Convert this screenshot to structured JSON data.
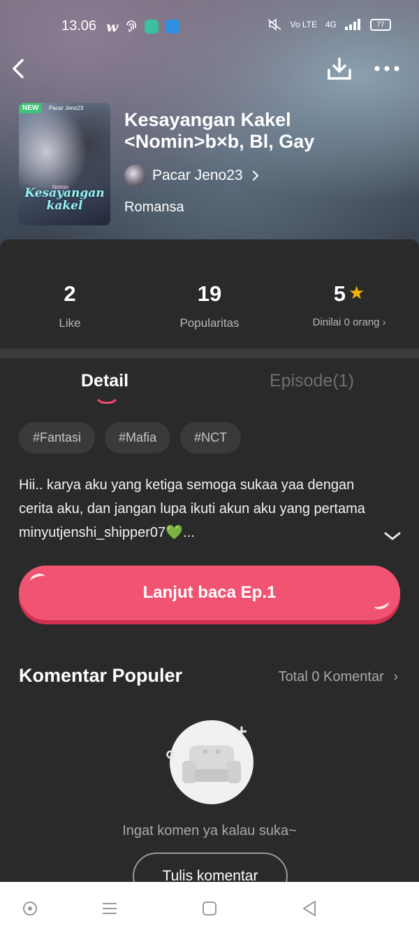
{
  "status_bar": {
    "time": "13.06",
    "app_icons": [
      "w-icon",
      "fingerprint-icon",
      "app-icon-1",
      "app-icon-2"
    ],
    "net_labels": [
      "Vo LTE",
      "4G"
    ],
    "battery": "77"
  },
  "header": {
    "badge": "NEW",
    "cover_author": "Pacar Jeno23",
    "cover_small": "Nomin",
    "cover_title": "Kesayangan kakel",
    "title": "Kesayangan Kakel <Nomin>b×b, Bl, Gay",
    "author": "Pacar Jeno23",
    "genre": "Romansa"
  },
  "stats": [
    {
      "value": "2",
      "label": "Like"
    },
    {
      "value": "19",
      "label": "Popularitas"
    },
    {
      "value": "5",
      "label": "Dinilai 0 orang"
    }
  ],
  "tabs": {
    "detail": "Detail",
    "episode": "Episode(1)"
  },
  "tags": [
    "#Fantasi",
    "#Mafia",
    "#NCT"
  ],
  "description": "Hii.. karya aku yang ketiga semoga sukaa yaa dengan cerita aku, dan jangan lupa ikuti akun aku yang pertama minyutjenshi_shipper07💚...",
  "read_button": "Lanjut baca Ep.1",
  "comments": {
    "title": "Komentar Populer",
    "total": "Total 0 Komentar",
    "empty_text": "Ingat komen ya kalau suka~",
    "write_button": "Tulis komentar"
  },
  "colors": {
    "accent": "#f15472",
    "star": "#f5b400",
    "background": "#2a2a2b"
  }
}
